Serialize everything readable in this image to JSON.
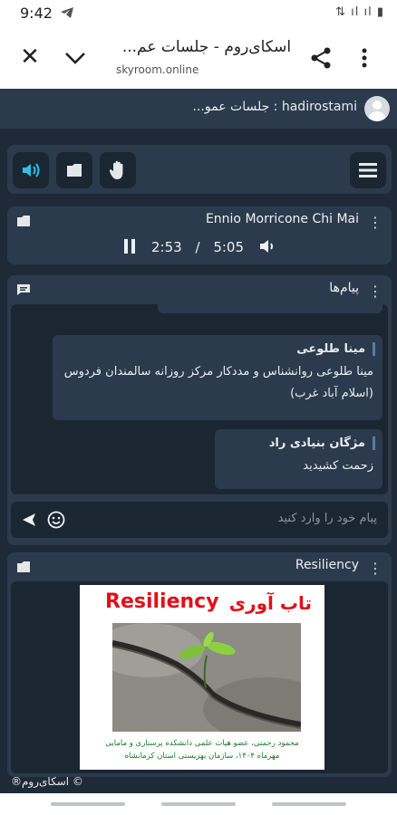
{
  "status": {
    "time": "9:42"
  },
  "browser": {
    "title": "اسکای‌روم - جلسات عم...",
    "url": "skyroom.online"
  },
  "user": {
    "label": "hadirostami : جلسات عمو..."
  },
  "player": {
    "title": "Ennio Morricone Chi Mai",
    "current": "2:53",
    "separator": "/",
    "duration": "5:05"
  },
  "chat": {
    "title": "پیام‌ها",
    "messages": [
      {
        "name": "مینا طلوعی",
        "text": "مینا طلوعی روانشناس و مددکار مرکز روزانه سالمندان فردوس (اسلام آباد غرب)"
      },
      {
        "name": "مژگان بنیادی راد",
        "text": "زحمت کشیدید"
      }
    ],
    "input_placeholder": "پیام خود را وارد کنید"
  },
  "slide": {
    "panel_title": "Resiliency",
    "heading_en": "Resiliency",
    "heading_fa": "تاب آوری",
    "credit_line1": "محمود رحمتی، عضو هیات علمی دانشکده پرستاری و مامایی",
    "credit_line2": "مهرماه ۱۴۰۴، سازمان بهزیستی استان کرمانشاه"
  },
  "footer": {
    "text": "© اسکای‌روم®"
  },
  "colors": {
    "accent": "#2cc2e8",
    "slide_red": "#e0101a",
    "slide_green": "#1a7a30"
  }
}
